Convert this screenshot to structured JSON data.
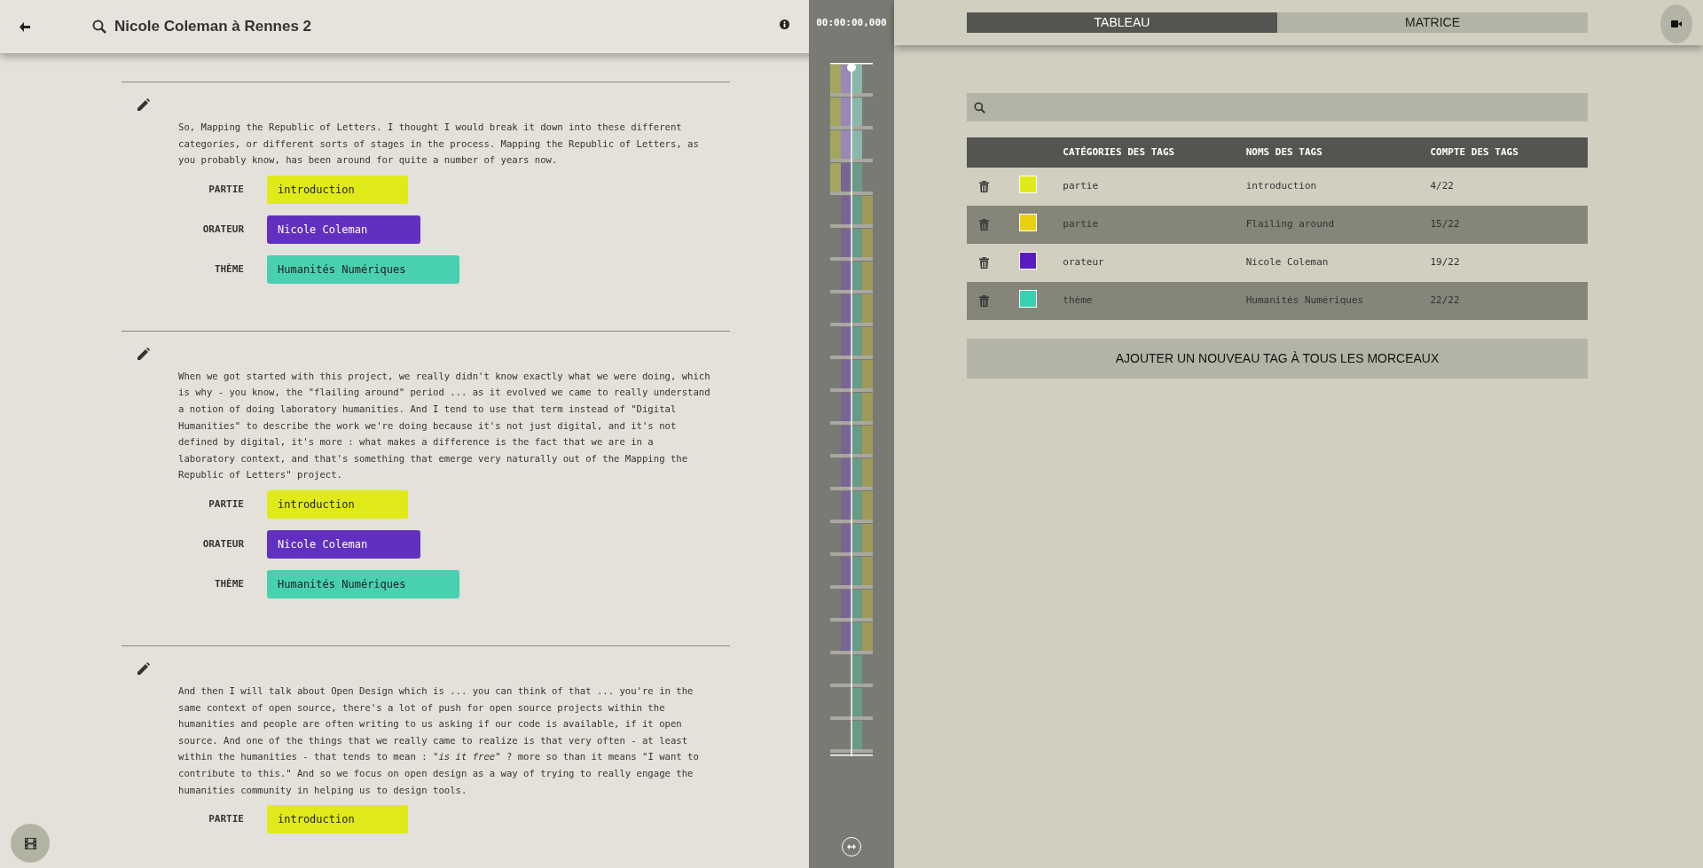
{
  "header": {
    "title": "Nicole Coleman à Rennes 2"
  },
  "timecode": "00:00:00,000",
  "segments": [
    {
      "text": "So, Mapping the Republic of Letters. I thought I would break it down into these different categories, or different sorts of stages in the process. Mapping the Republic of Letters, as you probably know, has been around for quite a number of years now.",
      "tags": [
        {
          "category": "PARTIE",
          "value": "introduction",
          "color": "#e0ea18"
        },
        {
          "category": "ORATEUR",
          "value": "Nicole Coleman",
          "color": "#6130c0"
        },
        {
          "category": "THÈME",
          "value": "Humanités Numériques",
          "color": "#48d0b0"
        }
      ]
    },
    {
      "text": "When we got started with this project, we really didn't know exactly what we were doing, which is why - you know, the \"flailing around\" period ... as it evolved we came to really understand a notion of doing laboratory humanities. And I tend to use that term instead of \"Digital Humanities\" to describe the work we're doing because it's not just digital, and it's not defined by digital, it's more : what makes a difference is the fact that we are in a laboratory context, and that's something that emerge very naturally out of the Mapping the Republic of Letters\" project.",
      "tags": [
        {
          "category": "PARTIE",
          "value": "introduction",
          "color": "#e0ea18"
        },
        {
          "category": "ORATEUR",
          "value": "Nicole Coleman",
          "color": "#6130c0"
        },
        {
          "category": "THÈME",
          "value": "Humanités Numériques",
          "color": "#48d0b0"
        }
      ]
    },
    {
      "text": "And then I will talk about Open Design which is ... you can think of that ... you're in the same context of open source, there's a lot of push for open source projects within the humanities and people are often writing to us asking if our code is available, if it open source. And one of the things that we really came to realize is that very often - at least within the humanities - that tends to mean : *\"is it free\"* ? more so than it means \"I want to contribute to this.\" And so we focus on open design as a way of trying to really engage the humanities community in helping us to design tools.",
      "tags": [
        {
          "category": "PARTIE",
          "value": "introduction",
          "color": "#e0ea18"
        }
      ]
    }
  ],
  "tabs": [
    {
      "label": "TABLEAU",
      "selected": true
    },
    {
      "label": "MATRICE",
      "selected": false
    }
  ],
  "table": {
    "columns": [
      "CATÉGORIES DES TAGS",
      "NOMS DES TAGS",
      "COMPTE DES TAGS"
    ],
    "rows": [
      {
        "color": "#e0ea18",
        "category": "partie",
        "name": "introduction",
        "count": "4/22"
      },
      {
        "color": "#e8d010",
        "category": "partie",
        "name": "Flailing around",
        "count": "15/22"
      },
      {
        "color": "#5a1cc0",
        "category": "orateur",
        "name": "Nicole Coleman",
        "count": "19/22"
      },
      {
        "color": "#38d0b0",
        "category": "thème",
        "name": "Humanités Numériques",
        "count": "22/22"
      }
    ]
  },
  "add_button": "AJOUTER UN NOUVEAU TAG À TOUS LES MORCEAUX"
}
